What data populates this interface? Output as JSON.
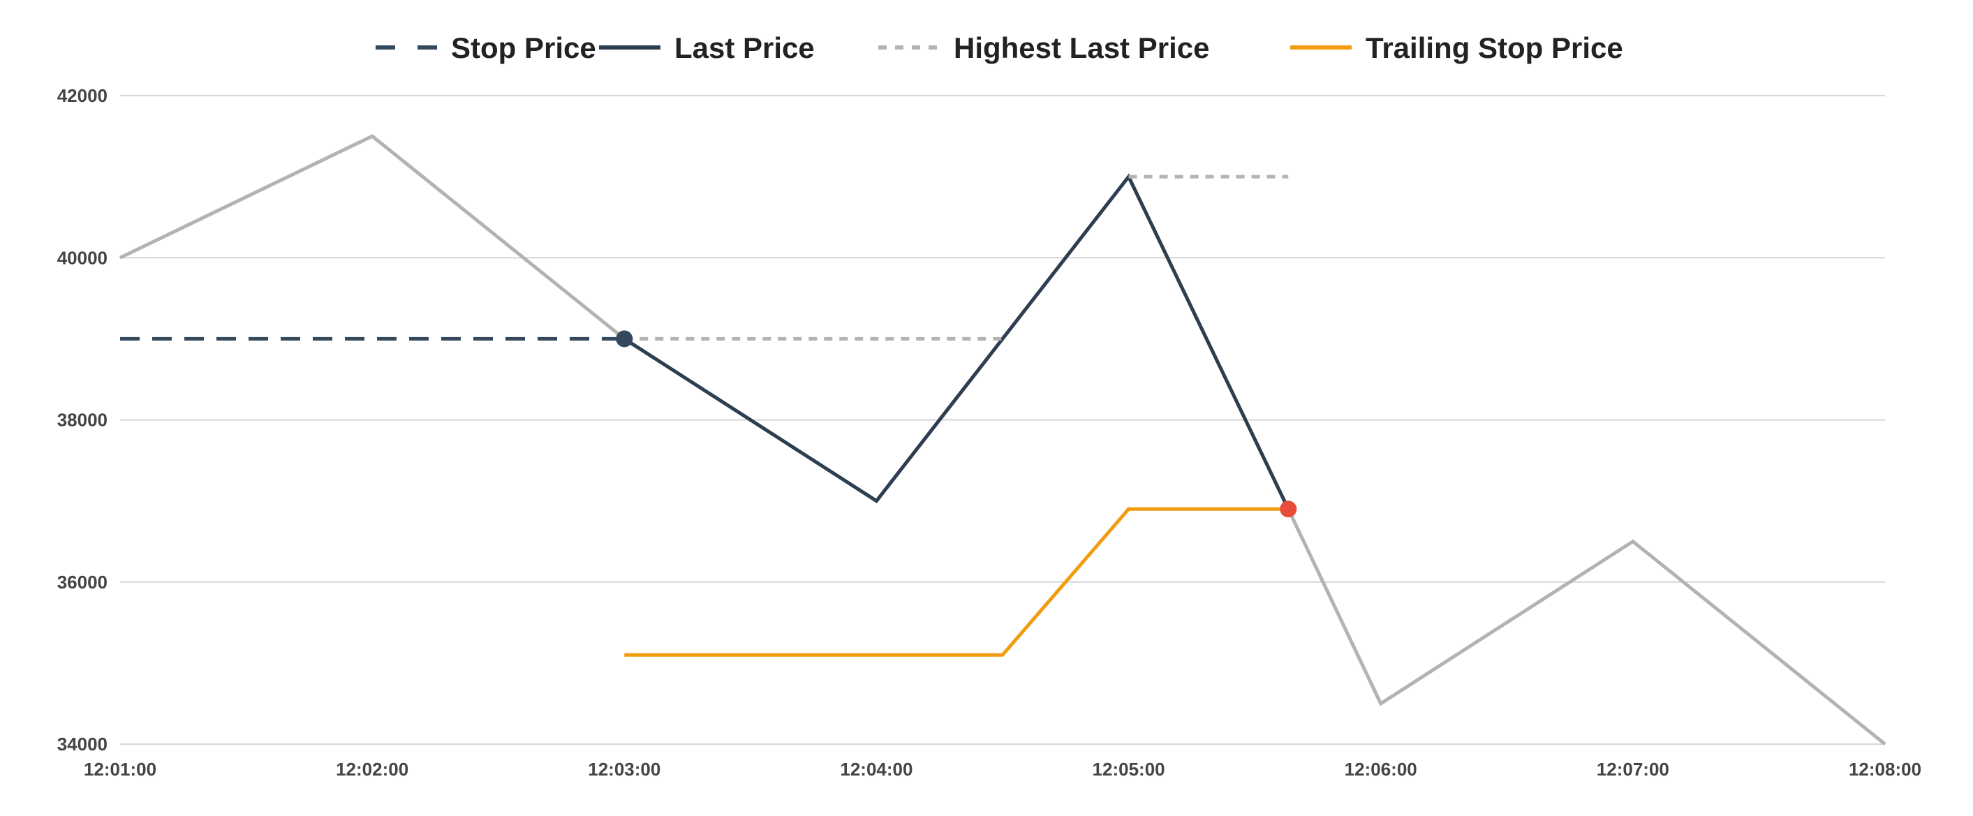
{
  "chart_data": {
    "type": "line",
    "title": "",
    "xlabel": "",
    "ylabel": "",
    "ylim": [
      34000,
      42000
    ],
    "yticks": [
      "34000",
      "36000",
      "38000",
      "40000",
      "42000"
    ],
    "xticks": [
      "12:01:00",
      "12:02:00",
      "12:03:00",
      "12:04:00",
      "12:05:00",
      "12:06:00",
      "12:07:00",
      "12:08:00"
    ],
    "grid": "horizontal",
    "legend_position": "top",
    "price_path": {
      "x": [
        "12:01:00",
        "12:02:00",
        "12:03:00",
        "12:04:00",
        "12:05:00",
        "12:05:38",
        "12:06:00",
        "12:07:00",
        "12:08:00"
      ],
      "y": [
        40000,
        41500,
        39000,
        37000,
        41000,
        36900,
        34500,
        36500,
        34000
      ],
      "color": "#b3b3b3"
    },
    "series": [
      {
        "name": "Stop Price",
        "style": "dashed",
        "color": "#34495e",
        "x": [
          "12:01:00",
          "12:03:00"
        ],
        "y": [
          39000,
          39000
        ]
      },
      {
        "name": "Last Price",
        "style": "solid",
        "color": "#2c3e50",
        "x": [
          "12:03:00",
          "12:04:00",
          "12:05:00",
          "12:05:38"
        ],
        "y": [
          39000,
          37000,
          41000,
          36900
        ]
      },
      {
        "name": "Highest Last Price",
        "style": "dotted",
        "color": "#b3b3b3",
        "segments": [
          {
            "x": [
              "12:03:00",
              "12:04:30"
            ],
            "y": [
              39000,
              39000
            ]
          },
          {
            "x": [
              "12:05:00",
              "12:05:38"
            ],
            "y": [
              41000,
              41000
            ]
          }
        ]
      },
      {
        "name": "Trailing Stop Price",
        "style": "solid",
        "color": "#f39c12",
        "x": [
          "12:03:00",
          "12:04:30",
          "12:05:00",
          "12:05:38"
        ],
        "y": [
          35100,
          35100,
          36900,
          36900
        ]
      }
    ],
    "markers": [
      {
        "x": "12:03:00",
        "y": 39000,
        "color": "#34495e"
      },
      {
        "x": "12:05:38",
        "y": 36900,
        "color": "#e74c3c"
      }
    ]
  }
}
